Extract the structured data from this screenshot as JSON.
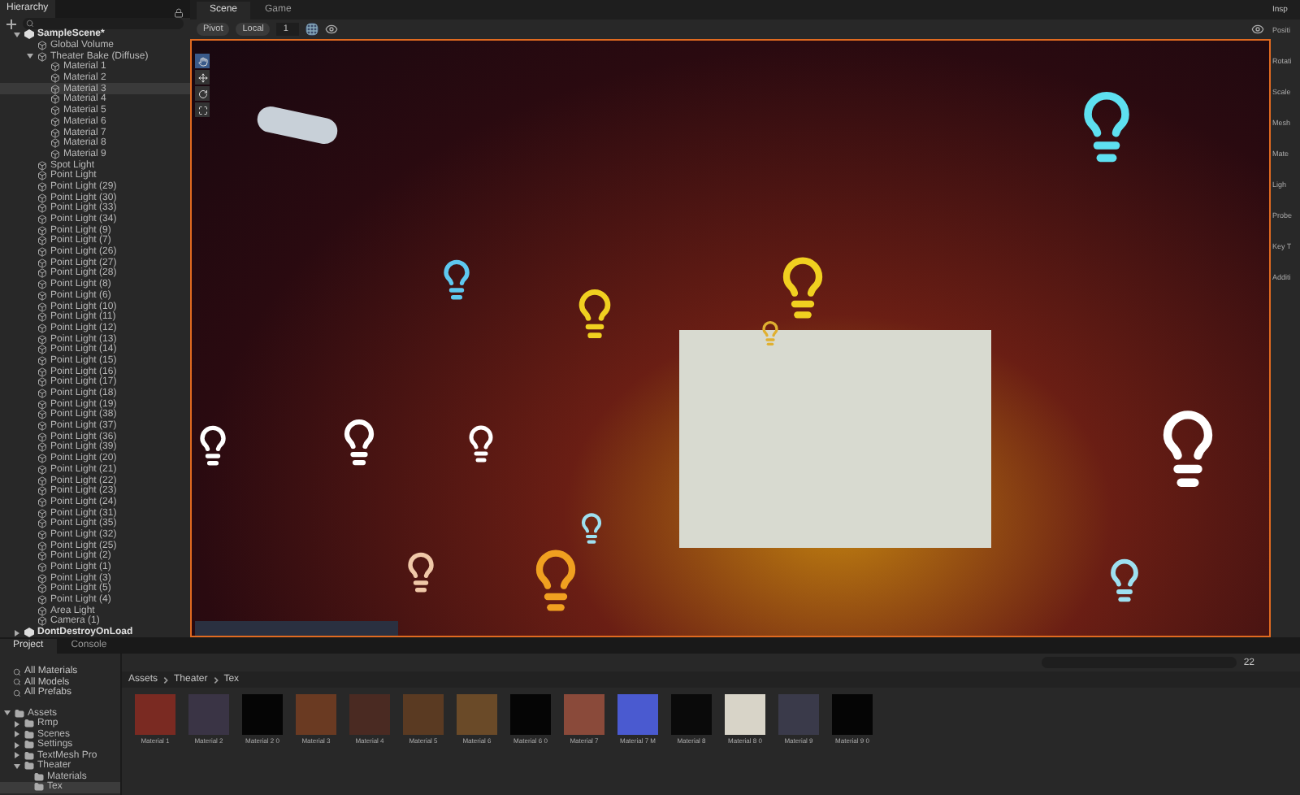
{
  "hierarchy": {
    "title": "Hierarchy",
    "tree": [
      {
        "label": "SampleScene*",
        "kind": "scene",
        "expanded": true,
        "selected": false,
        "children": [
          {
            "label": "Global Volume",
            "kind": "object",
            "selected": false
          },
          {
            "label": "Theater Bake (Diffuse)",
            "kind": "object",
            "expanded": true,
            "selected": false,
            "children": [
              {
                "label": "Material 1",
                "kind": "object",
                "selected": false
              },
              {
                "label": "Material 2",
                "kind": "object",
                "selected": false
              },
              {
                "label": "Material 3",
                "kind": "object",
                "selected": true
              },
              {
                "label": "Material 4",
                "kind": "object",
                "selected": false
              },
              {
                "label": "Material 5",
                "kind": "object",
                "selected": false
              },
              {
                "label": "Material 6",
                "kind": "object",
                "selected": false
              },
              {
                "label": "Material 7",
                "kind": "object",
                "selected": false
              },
              {
                "label": "Material 8",
                "kind": "object",
                "selected": false
              },
              {
                "label": "Material 9",
                "kind": "object",
                "selected": false
              }
            ]
          },
          {
            "label": "Spot Light",
            "kind": "object",
            "selected": false
          },
          {
            "label": "Point Light",
            "kind": "object",
            "selected": false
          },
          {
            "label": "Point Light (29)",
            "kind": "object",
            "selected": false
          },
          {
            "label": "Point Light (30)",
            "kind": "object",
            "selected": false
          },
          {
            "label": "Point Light (33)",
            "kind": "object",
            "selected": false
          },
          {
            "label": "Point Light (34)",
            "kind": "object",
            "selected": false
          },
          {
            "label": "Point Light (9)",
            "kind": "object",
            "selected": false
          },
          {
            "label": "Point Light (7)",
            "kind": "object",
            "selected": false
          },
          {
            "label": "Point Light (26)",
            "kind": "object",
            "selected": false
          },
          {
            "label": "Point Light (27)",
            "kind": "object",
            "selected": false
          },
          {
            "label": "Point Light (28)",
            "kind": "object",
            "selected": false
          },
          {
            "label": "Point Light (8)",
            "kind": "object",
            "selected": false
          },
          {
            "label": "Point Light (6)",
            "kind": "object",
            "selected": false
          },
          {
            "label": "Point Light (10)",
            "kind": "object",
            "selected": false
          },
          {
            "label": "Point Light (11)",
            "kind": "object",
            "selected": false
          },
          {
            "label": "Point Light (12)",
            "kind": "object",
            "selected": false
          },
          {
            "label": "Point Light (13)",
            "kind": "object",
            "selected": false
          },
          {
            "label": "Point Light (14)",
            "kind": "object",
            "selected": false
          },
          {
            "label": "Point Light (15)",
            "kind": "object",
            "selected": false
          },
          {
            "label": "Point Light (16)",
            "kind": "object",
            "selected": false
          },
          {
            "label": "Point Light (17)",
            "kind": "object",
            "selected": false
          },
          {
            "label": "Point Light (18)",
            "kind": "object",
            "selected": false
          },
          {
            "label": "Point Light (19)",
            "kind": "object",
            "selected": false
          },
          {
            "label": "Point Light (38)",
            "kind": "object",
            "selected": false
          },
          {
            "label": "Point Light (37)",
            "kind": "object",
            "selected": false
          },
          {
            "label": "Point Light (36)",
            "kind": "object",
            "selected": false
          },
          {
            "label": "Point Light (39)",
            "kind": "object",
            "selected": false
          },
          {
            "label": "Point Light (20)",
            "kind": "object",
            "selected": false
          },
          {
            "label": "Point Light (21)",
            "kind": "object",
            "selected": false
          },
          {
            "label": "Point Light (22)",
            "kind": "object",
            "selected": false
          },
          {
            "label": "Point Light (23)",
            "kind": "object",
            "selected": false
          },
          {
            "label": "Point Light (24)",
            "kind": "object",
            "selected": false
          },
          {
            "label": "Point Light (31)",
            "kind": "object",
            "selected": false
          },
          {
            "label": "Point Light (35)",
            "kind": "object",
            "selected": false
          },
          {
            "label": "Point Light (32)",
            "kind": "object",
            "selected": false
          },
          {
            "label": "Point Light (25)",
            "kind": "object",
            "selected": false
          },
          {
            "label": "Point Light (2)",
            "kind": "object",
            "selected": false
          },
          {
            "label": "Point Light (1)",
            "kind": "object",
            "selected": false
          },
          {
            "label": "Point Light (3)",
            "kind": "object",
            "selected": false
          },
          {
            "label": "Point Light (5)",
            "kind": "object",
            "selected": false
          },
          {
            "label": "Point Light (4)",
            "kind": "object",
            "selected": false
          },
          {
            "label": "Area Light",
            "kind": "object",
            "selected": false
          },
          {
            "label": "Camera (1)",
            "kind": "object",
            "selected": false
          }
        ]
      },
      {
        "label": "DontDestroyOnLoad",
        "kind": "scene",
        "expanded": false,
        "selected": false
      }
    ]
  },
  "view_tabs": [
    {
      "label": "Scene",
      "selected": true
    },
    {
      "label": "Game",
      "selected": false
    }
  ],
  "scene_toolbar": {
    "pivot": "Pivot",
    "space": "Local",
    "grid_size": "1"
  },
  "inspector": {
    "title": "Insp",
    "labels": [
      "Positi",
      "Rotati",
      "Scale",
      "Mesh",
      "Mate",
      "Ligh",
      "Probe",
      "Key T",
      "Additi"
    ]
  },
  "bottom_tabs": [
    {
      "label": "Project",
      "selected": true
    },
    {
      "label": "Console",
      "selected": false
    }
  ],
  "project": {
    "favorites": [
      "All Materials",
      "All Models",
      "All Prefabs"
    ],
    "tree": [
      {
        "label": "Assets",
        "expanded": true,
        "selected": false,
        "children": [
          {
            "label": "Rmp",
            "expanded": false,
            "selected": false
          },
          {
            "label": "Scenes",
            "expanded": false,
            "selected": false
          },
          {
            "label": "Settings",
            "expanded": false,
            "selected": false
          },
          {
            "label": "TextMesh Pro",
            "expanded": false,
            "selected": false
          },
          {
            "label": "Theater",
            "expanded": true,
            "selected": false,
            "children": [
              {
                "label": "Materials",
                "selected": false
              },
              {
                "label": "Tex",
                "selected": true
              }
            ]
          }
        ]
      }
    ],
    "breadcrumb": [
      "Assets",
      "Theater",
      "Tex"
    ],
    "item_count": "22",
    "assets": [
      {
        "name": "Material 1",
        "color": "#7a2a22"
      },
      {
        "name": "Material 2",
        "color": "#3a3445"
      },
      {
        "name": "Material 2 0",
        "color": "#050505"
      },
      {
        "name": "Material 3",
        "color": "#6a3a22"
      },
      {
        "name": "Material 4",
        "color": "#4a2a22"
      },
      {
        "name": "Material 5",
        "color": "#5a3a22"
      },
      {
        "name": "Material 6",
        "color": "#6a4a28"
      },
      {
        "name": "Material 6 0",
        "color": "#050505"
      },
      {
        "name": "Material 7",
        "color": "#8a4a3a"
      },
      {
        "name": "Material 7 M",
        "color": "#4a5ad0"
      },
      {
        "name": "Material 8",
        "color": "#0a0a0a"
      },
      {
        "name": "Material 8 0",
        "color": "#d8d4c8"
      },
      {
        "name": "Material 9",
        "color": "#3a3a4a"
      },
      {
        "name": "Material 9 0",
        "color": "#050505"
      }
    ]
  }
}
